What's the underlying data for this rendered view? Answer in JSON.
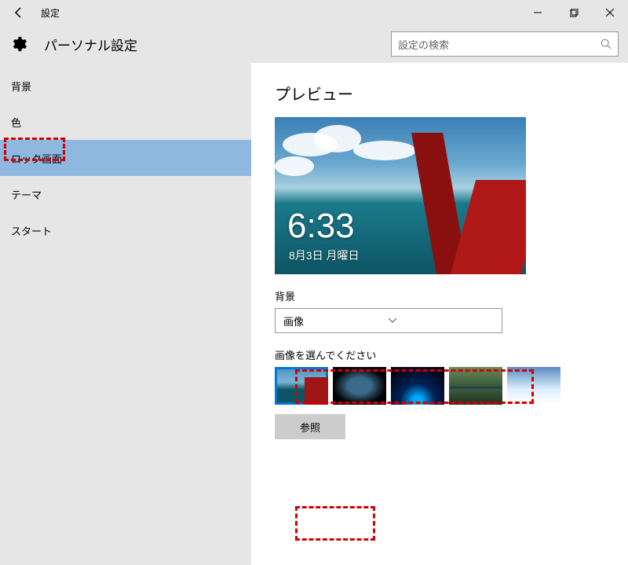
{
  "window": {
    "title": "設定",
    "min": "─",
    "max": "❐",
    "close": "✕"
  },
  "header": {
    "title": "パーソナル設定",
    "search_placeholder": "設定の検索"
  },
  "sidebar": {
    "items": [
      {
        "label": "背景"
      },
      {
        "label": "色"
      },
      {
        "label": "ロック画面",
        "selected": true
      },
      {
        "label": "テーマ"
      },
      {
        "label": "スタート"
      }
    ]
  },
  "main": {
    "preview_title": "プレビュー",
    "preview_time": "6:33",
    "preview_date": "8月3日 月曜日",
    "background_label": "背景",
    "background_dropdown": "画像",
    "choose_label": "画像を選んでください",
    "browse_label": "参照"
  }
}
